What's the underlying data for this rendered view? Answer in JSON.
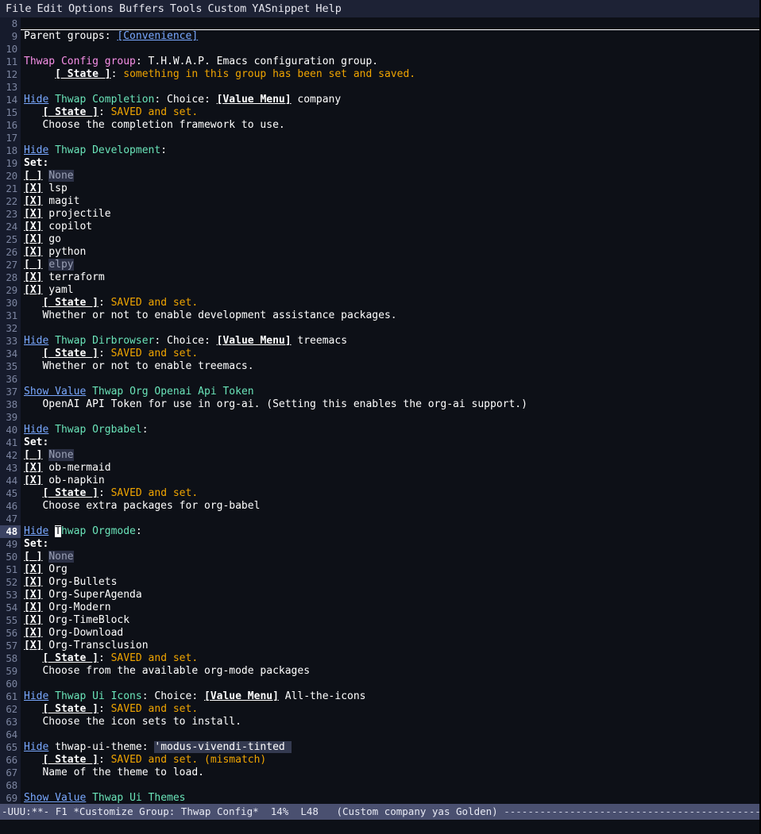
{
  "menubar": {
    "items": [
      "File",
      "Edit",
      "Options",
      "Buffers",
      "Tools",
      "Custom",
      "YASnippet",
      "Help"
    ]
  },
  "colors": {
    "background": "#0d1017",
    "gutter_bg": "#161b2c",
    "gutter_fg": "#7c85a0",
    "current_line_bg": "#3b4363",
    "menubar_bg": "#1d2235",
    "modeline_bg": "#4a5070",
    "link": "#79a8ff",
    "group_title": "#f78fe7",
    "group_name": "#6ae4b9",
    "state_value": "#f0a500",
    "field_bg": "#343a50",
    "off_bg": "#2b3045",
    "off_fg": "#9aa0b5",
    "foreground": "#ffffff"
  },
  "buffer": {
    "first_line": 8,
    "current_line": 48,
    "lines": [
      {
        "n": 8,
        "rule": true,
        "segs": []
      },
      {
        "n": 9,
        "segs": [
          {
            "t": "Parent groups: ",
            "c": "f-plain"
          },
          {
            "t": "[Convenience]",
            "c": "f-link"
          }
        ]
      },
      {
        "n": 10,
        "segs": []
      },
      {
        "n": 11,
        "segs": [
          {
            "t": "Thwap Config group",
            "c": "f-group"
          },
          {
            "t": ": T.H.W.A.P. Emacs configuration group.",
            "c": "f-plain"
          }
        ]
      },
      {
        "n": 12,
        "segs": [
          {
            "t": "     ",
            "c": "f-plain"
          },
          {
            "t": "[ State ]",
            "c": "f-state"
          },
          {
            "t": ": ",
            "c": "f-plain"
          },
          {
            "t": "something in this group has been set and saved.",
            "c": "f-stateval"
          }
        ]
      },
      {
        "n": 13,
        "segs": []
      },
      {
        "n": 14,
        "segs": [
          {
            "t": "Hide",
            "c": "f-link"
          },
          {
            "t": " ",
            "c": "f-plain"
          },
          {
            "t": "Thwap Completion",
            "c": "f-groupname"
          },
          {
            "t": ": Choice: ",
            "c": "f-plain"
          },
          {
            "t": "[Value Menu]",
            "c": "f-btn"
          },
          {
            "t": " company",
            "c": "f-plain"
          }
        ]
      },
      {
        "n": 15,
        "segs": [
          {
            "t": "   ",
            "c": "f-plain"
          },
          {
            "t": "[ State ]",
            "c": "f-state"
          },
          {
            "t": ": ",
            "c": "f-plain"
          },
          {
            "t": "SAVED and set.",
            "c": "f-stateval"
          }
        ]
      },
      {
        "n": 16,
        "segs": [
          {
            "t": "   Choose the completion framework to use.",
            "c": "f-doc"
          }
        ]
      },
      {
        "n": 17,
        "segs": []
      },
      {
        "n": 18,
        "segs": [
          {
            "t": "Hide",
            "c": "f-link"
          },
          {
            "t": " ",
            "c": "f-plain"
          },
          {
            "t": "Thwap Development",
            "c": "f-groupname"
          },
          {
            "t": ":",
            "c": "f-plain"
          }
        ]
      },
      {
        "n": 19,
        "segs": [
          {
            "t": "Set:",
            "c": "f-bold"
          }
        ]
      },
      {
        "n": 20,
        "segs": [
          {
            "t": "[ ]",
            "c": "f-box"
          },
          {
            "t": " ",
            "c": "f-plain"
          },
          {
            "t": "None",
            "c": "f-off"
          }
        ]
      },
      {
        "n": 21,
        "segs": [
          {
            "t": "[X]",
            "c": "f-box"
          },
          {
            "t": " lsp",
            "c": "f-on"
          }
        ]
      },
      {
        "n": 22,
        "segs": [
          {
            "t": "[X]",
            "c": "f-box"
          },
          {
            "t": " magit",
            "c": "f-on"
          }
        ]
      },
      {
        "n": 23,
        "segs": [
          {
            "t": "[X]",
            "c": "f-box"
          },
          {
            "t": " projectile",
            "c": "f-on"
          }
        ]
      },
      {
        "n": 24,
        "segs": [
          {
            "t": "[X]",
            "c": "f-box"
          },
          {
            "t": " copilot",
            "c": "f-on"
          }
        ]
      },
      {
        "n": 25,
        "segs": [
          {
            "t": "[X]",
            "c": "f-box"
          },
          {
            "t": " go",
            "c": "f-on"
          }
        ]
      },
      {
        "n": 26,
        "segs": [
          {
            "t": "[X]",
            "c": "f-box"
          },
          {
            "t": " python",
            "c": "f-on"
          }
        ]
      },
      {
        "n": 27,
        "segs": [
          {
            "t": "[ ]",
            "c": "f-box"
          },
          {
            "t": " ",
            "c": "f-plain"
          },
          {
            "t": "elpy",
            "c": "f-off"
          }
        ]
      },
      {
        "n": 28,
        "segs": [
          {
            "t": "[X]",
            "c": "f-box"
          },
          {
            "t": " terraform",
            "c": "f-on"
          }
        ]
      },
      {
        "n": 29,
        "segs": [
          {
            "t": "[X]",
            "c": "f-box"
          },
          {
            "t": " yaml",
            "c": "f-on"
          }
        ]
      },
      {
        "n": 30,
        "segs": [
          {
            "t": "   ",
            "c": "f-plain"
          },
          {
            "t": "[ State ]",
            "c": "f-state"
          },
          {
            "t": ": ",
            "c": "f-plain"
          },
          {
            "t": "SAVED and set.",
            "c": "f-stateval"
          }
        ]
      },
      {
        "n": 31,
        "segs": [
          {
            "t": "   Whether or not to enable development assistance packages.",
            "c": "f-doc"
          }
        ]
      },
      {
        "n": 32,
        "segs": []
      },
      {
        "n": 33,
        "segs": [
          {
            "t": "Hide",
            "c": "f-link"
          },
          {
            "t": " ",
            "c": "f-plain"
          },
          {
            "t": "Thwap Dirbrowser",
            "c": "f-groupname"
          },
          {
            "t": ": Choice: ",
            "c": "f-plain"
          },
          {
            "t": "[Value Menu]",
            "c": "f-btn"
          },
          {
            "t": " treemacs",
            "c": "f-plain"
          }
        ]
      },
      {
        "n": 34,
        "segs": [
          {
            "t": "   ",
            "c": "f-plain"
          },
          {
            "t": "[ State ]",
            "c": "f-state"
          },
          {
            "t": ": ",
            "c": "f-plain"
          },
          {
            "t": "SAVED and set.",
            "c": "f-stateval"
          }
        ]
      },
      {
        "n": 35,
        "segs": [
          {
            "t": "   Whether or not to enable treemacs.",
            "c": "f-doc"
          }
        ]
      },
      {
        "n": 36,
        "segs": []
      },
      {
        "n": 37,
        "segs": [
          {
            "t": "Show Value",
            "c": "f-link"
          },
          {
            "t": " ",
            "c": "f-plain"
          },
          {
            "t": "Thwap Org Openai Api Token",
            "c": "f-groupname"
          }
        ]
      },
      {
        "n": 38,
        "segs": [
          {
            "t": "   OpenAI API Token for use in org-ai. (Setting this enables the org-ai support.)",
            "c": "f-doc"
          }
        ]
      },
      {
        "n": 39,
        "segs": []
      },
      {
        "n": 40,
        "segs": [
          {
            "t": "Hide",
            "c": "f-link"
          },
          {
            "t": " ",
            "c": "f-plain"
          },
          {
            "t": "Thwap Orgbabel",
            "c": "f-groupname"
          },
          {
            "t": ":",
            "c": "f-plain"
          }
        ]
      },
      {
        "n": 41,
        "segs": [
          {
            "t": "Set:",
            "c": "f-bold"
          }
        ]
      },
      {
        "n": 42,
        "segs": [
          {
            "t": "[ ]",
            "c": "f-box"
          },
          {
            "t": " ",
            "c": "f-plain"
          },
          {
            "t": "None",
            "c": "f-off"
          }
        ]
      },
      {
        "n": 43,
        "segs": [
          {
            "t": "[X]",
            "c": "f-box"
          },
          {
            "t": " ob-mermaid",
            "c": "f-on"
          }
        ]
      },
      {
        "n": 44,
        "segs": [
          {
            "t": "[X]",
            "c": "f-box"
          },
          {
            "t": " ob-napkin",
            "c": "f-on"
          }
        ]
      },
      {
        "n": 45,
        "segs": [
          {
            "t": "   ",
            "c": "f-plain"
          },
          {
            "t": "[ State ]",
            "c": "f-state"
          },
          {
            "t": ": ",
            "c": "f-plain"
          },
          {
            "t": "SAVED and set.",
            "c": "f-stateval"
          }
        ]
      },
      {
        "n": 46,
        "segs": [
          {
            "t": "   Choose extra packages for org-babel",
            "c": "f-doc"
          }
        ]
      },
      {
        "n": 47,
        "segs": []
      },
      {
        "n": 48,
        "cur": true,
        "segs": [
          {
            "t": "Hide",
            "c": "f-link"
          },
          {
            "t": " ",
            "c": "f-plain"
          },
          {
            "t": "T",
            "c": "f-groupname cursor"
          },
          {
            "t": "hwap Orgmode",
            "c": "f-groupname"
          },
          {
            "t": ":",
            "c": "f-plain"
          }
        ]
      },
      {
        "n": 49,
        "segs": [
          {
            "t": "Set:",
            "c": "f-bold"
          }
        ]
      },
      {
        "n": 50,
        "segs": [
          {
            "t": "[ ]",
            "c": "f-box"
          },
          {
            "t": " ",
            "c": "f-plain"
          },
          {
            "t": "None",
            "c": "f-off"
          }
        ]
      },
      {
        "n": 51,
        "segs": [
          {
            "t": "[X]",
            "c": "f-box"
          },
          {
            "t": " Org",
            "c": "f-on"
          }
        ]
      },
      {
        "n": 52,
        "segs": [
          {
            "t": "[X]",
            "c": "f-box"
          },
          {
            "t": " Org-Bullets",
            "c": "f-on"
          }
        ]
      },
      {
        "n": 53,
        "segs": [
          {
            "t": "[X]",
            "c": "f-box"
          },
          {
            "t": " Org-SuperAgenda",
            "c": "f-on"
          }
        ]
      },
      {
        "n": 54,
        "segs": [
          {
            "t": "[X]",
            "c": "f-box"
          },
          {
            "t": " Org-Modern",
            "c": "f-on"
          }
        ]
      },
      {
        "n": 55,
        "segs": [
          {
            "t": "[X]",
            "c": "f-box"
          },
          {
            "t": " Org-TimeBlock",
            "c": "f-on"
          }
        ]
      },
      {
        "n": 56,
        "segs": [
          {
            "t": "[X]",
            "c": "f-box"
          },
          {
            "t": " Org-Download",
            "c": "f-on"
          }
        ]
      },
      {
        "n": 57,
        "segs": [
          {
            "t": "[X]",
            "c": "f-box"
          },
          {
            "t": " Org-Transclusion",
            "c": "f-on"
          }
        ]
      },
      {
        "n": 58,
        "segs": [
          {
            "t": "   ",
            "c": "f-plain"
          },
          {
            "t": "[ State ]",
            "c": "f-state"
          },
          {
            "t": ": ",
            "c": "f-plain"
          },
          {
            "t": "SAVED and set.",
            "c": "f-stateval"
          }
        ]
      },
      {
        "n": 59,
        "segs": [
          {
            "t": "   Choose from the available org-mode packages",
            "c": "f-doc"
          }
        ]
      },
      {
        "n": 60,
        "segs": []
      },
      {
        "n": 61,
        "segs": [
          {
            "t": "Hide",
            "c": "f-link"
          },
          {
            "t": " ",
            "c": "f-plain"
          },
          {
            "t": "Thwap Ui Icons",
            "c": "f-groupname"
          },
          {
            "t": ": Choice: ",
            "c": "f-plain"
          },
          {
            "t": "[Value Menu]",
            "c": "f-btn"
          },
          {
            "t": " All-the-icons",
            "c": "f-plain"
          }
        ]
      },
      {
        "n": 62,
        "segs": [
          {
            "t": "   ",
            "c": "f-plain"
          },
          {
            "t": "[ State ]",
            "c": "f-state"
          },
          {
            "t": ": ",
            "c": "f-plain"
          },
          {
            "t": "SAVED and set.",
            "c": "f-stateval"
          }
        ]
      },
      {
        "n": 63,
        "segs": [
          {
            "t": "   Choose the icon sets to install.",
            "c": "f-doc"
          }
        ]
      },
      {
        "n": 64,
        "segs": []
      },
      {
        "n": 65,
        "segs": [
          {
            "t": "Hide",
            "c": "f-link"
          },
          {
            "t": " thwap-ui-theme: ",
            "c": "f-plain"
          },
          {
            "t": "'modus-vivendi-tinted ",
            "c": "f-field"
          }
        ]
      },
      {
        "n": 66,
        "segs": [
          {
            "t": "   ",
            "c": "f-plain"
          },
          {
            "t": "[ State ]",
            "c": "f-state"
          },
          {
            "t": ": ",
            "c": "f-plain"
          },
          {
            "t": "SAVED and set. (mismatch)",
            "c": "f-stateval"
          }
        ]
      },
      {
        "n": 67,
        "segs": [
          {
            "t": "   Name of the theme to load.",
            "c": "f-doc"
          }
        ]
      },
      {
        "n": 68,
        "segs": []
      },
      {
        "n": 69,
        "segs": [
          {
            "t": "Show Value",
            "c": "f-link"
          },
          {
            "t": " ",
            "c": "f-plain"
          },
          {
            "t": "Thwap Ui Themes",
            "c": "f-groupname"
          }
        ]
      }
    ]
  },
  "modeline": {
    "status": "-UUU:**-",
    "frame": "F1",
    "buffer_name": "*Customize Group: Thwap Config*",
    "percent": "14%",
    "line_indicator": "L48",
    "modes": "(Custom company yas Golden)",
    "filler": "-------------------------------------------------------------"
  }
}
